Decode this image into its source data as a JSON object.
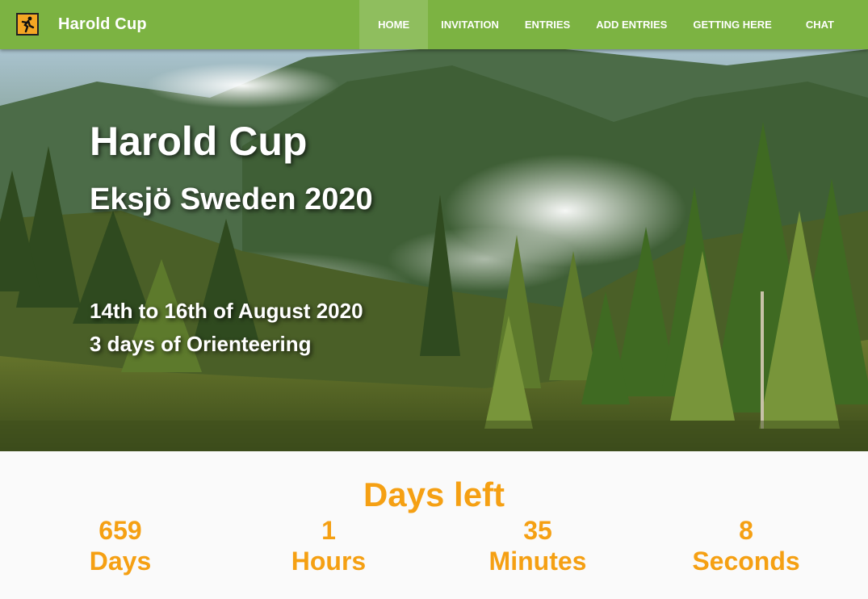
{
  "nav": {
    "brand": "Harold Cup",
    "items": [
      {
        "label": "HOME",
        "active": true
      },
      {
        "label": "INVITATION",
        "active": false
      },
      {
        "label": "ENTRIES",
        "active": false
      },
      {
        "label": "ADD ENTRIES",
        "active": false
      },
      {
        "label": "GETTING HERE",
        "active": false
      },
      {
        "label": "CHAT",
        "active": false
      }
    ]
  },
  "hero": {
    "title": "Harold Cup",
    "subtitle": "Eksjö Sweden 2020",
    "dates": "14th to 16th of August 2020",
    "description": "3 days of Orienteering"
  },
  "countdown": {
    "heading": "Days left",
    "units": [
      {
        "value": "659",
        "label": "Days"
      },
      {
        "value": "1",
        "label": "Hours"
      },
      {
        "value": "35",
        "label": "Minutes"
      },
      {
        "value": "8",
        "label": "Seconds"
      }
    ]
  },
  "colors": {
    "navbar": "#7cb342",
    "accent": "#f5a013",
    "logo": "#f5a623"
  },
  "icons": {
    "logo": "orienteering-runner-icon"
  }
}
